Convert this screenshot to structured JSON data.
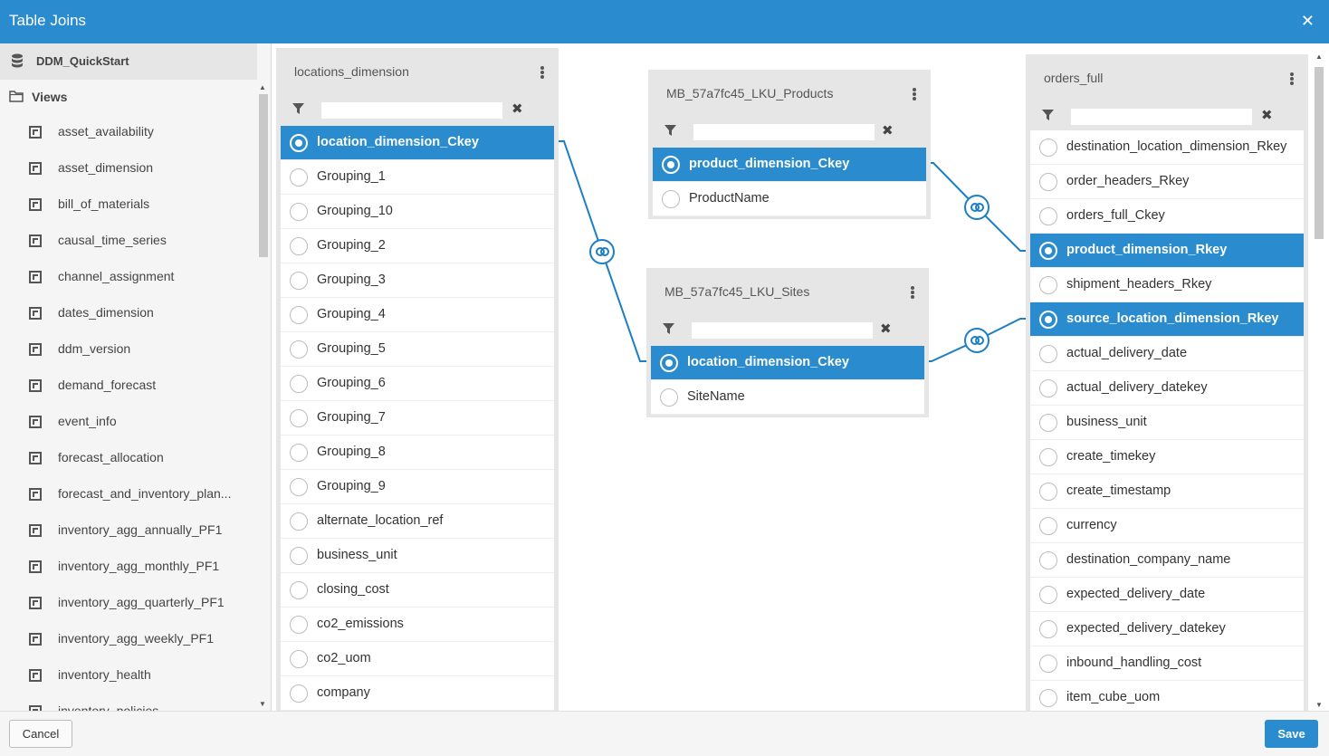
{
  "window": {
    "title": "Table Joins",
    "close_glyph": "✕"
  },
  "sidebar": {
    "database": "DDM_QuickStart",
    "views_label": "Views",
    "items": [
      "asset_availability",
      "asset_dimension",
      "bill_of_materials",
      "causal_time_series",
      "channel_assignment",
      "dates_dimension",
      "ddm_version",
      "demand_forecast",
      "event_info",
      "forecast_allocation",
      "forecast_and_inventory_plan...",
      "inventory_agg_annually_PF1",
      "inventory_agg_monthly_PF1",
      "inventory_agg_quarterly_PF1",
      "inventory_agg_weekly_PF1",
      "inventory_health",
      "inventory_policies"
    ]
  },
  "tables": {
    "locations": {
      "name": "locations_dimension",
      "selected": "location_dimension_Ckey",
      "columns": [
        "location_dimension_Ckey",
        "Grouping_1",
        "Grouping_10",
        "Grouping_2",
        "Grouping_3",
        "Grouping_4",
        "Grouping_5",
        "Grouping_6",
        "Grouping_7",
        "Grouping_8",
        "Grouping_9",
        "alternate_location_ref",
        "business_unit",
        "closing_cost",
        "co2_emissions",
        "co2_uom",
        "company"
      ]
    },
    "products": {
      "name": "MB_57a7fc45_LKU_Products",
      "selected": "product_dimension_Ckey",
      "columns": [
        "product_dimension_Ckey",
        "ProductName"
      ]
    },
    "sites": {
      "name": "MB_57a7fc45_LKU_Sites",
      "selected": "location_dimension_Ckey",
      "columns": [
        "location_dimension_Ckey",
        "SiteName"
      ]
    },
    "orders": {
      "name": "orders_full",
      "selected": [
        "product_dimension_Rkey",
        "source_location_dimension_Rkey"
      ],
      "columns": [
        "destination_location_dimension_Rkey",
        "order_headers_Rkey",
        "orders_full_Ckey",
        "product_dimension_Rkey",
        "shipment_headers_Rkey",
        "source_location_dimension_Rkey",
        "actual_delivery_date",
        "actual_delivery_datekey",
        "business_unit",
        "create_timekey",
        "create_timestamp",
        "currency",
        "destination_company_name",
        "expected_delivery_date",
        "expected_delivery_datekey",
        "inbound_handling_cost",
        "item_cube_uom"
      ]
    }
  },
  "joins": [
    {
      "from": "locations_dimension.location_dimension_Ckey",
      "to": "MB_57a7fc45_LKU_Sites.location_dimension_Ckey"
    },
    {
      "from": "MB_57a7fc45_LKU_Products.product_dimension_Ckey",
      "to": "orders_full.product_dimension_Rkey"
    },
    {
      "from": "MB_57a7fc45_LKU_Sites.location_dimension_Ckey",
      "to": "orders_full.source_location_dimension_Rkey"
    }
  ],
  "footer": {
    "cancel_label": "Cancel",
    "save_label": "Save"
  },
  "colors": {
    "accent": "#2a8ccf",
    "link": "#1c7fc4"
  }
}
